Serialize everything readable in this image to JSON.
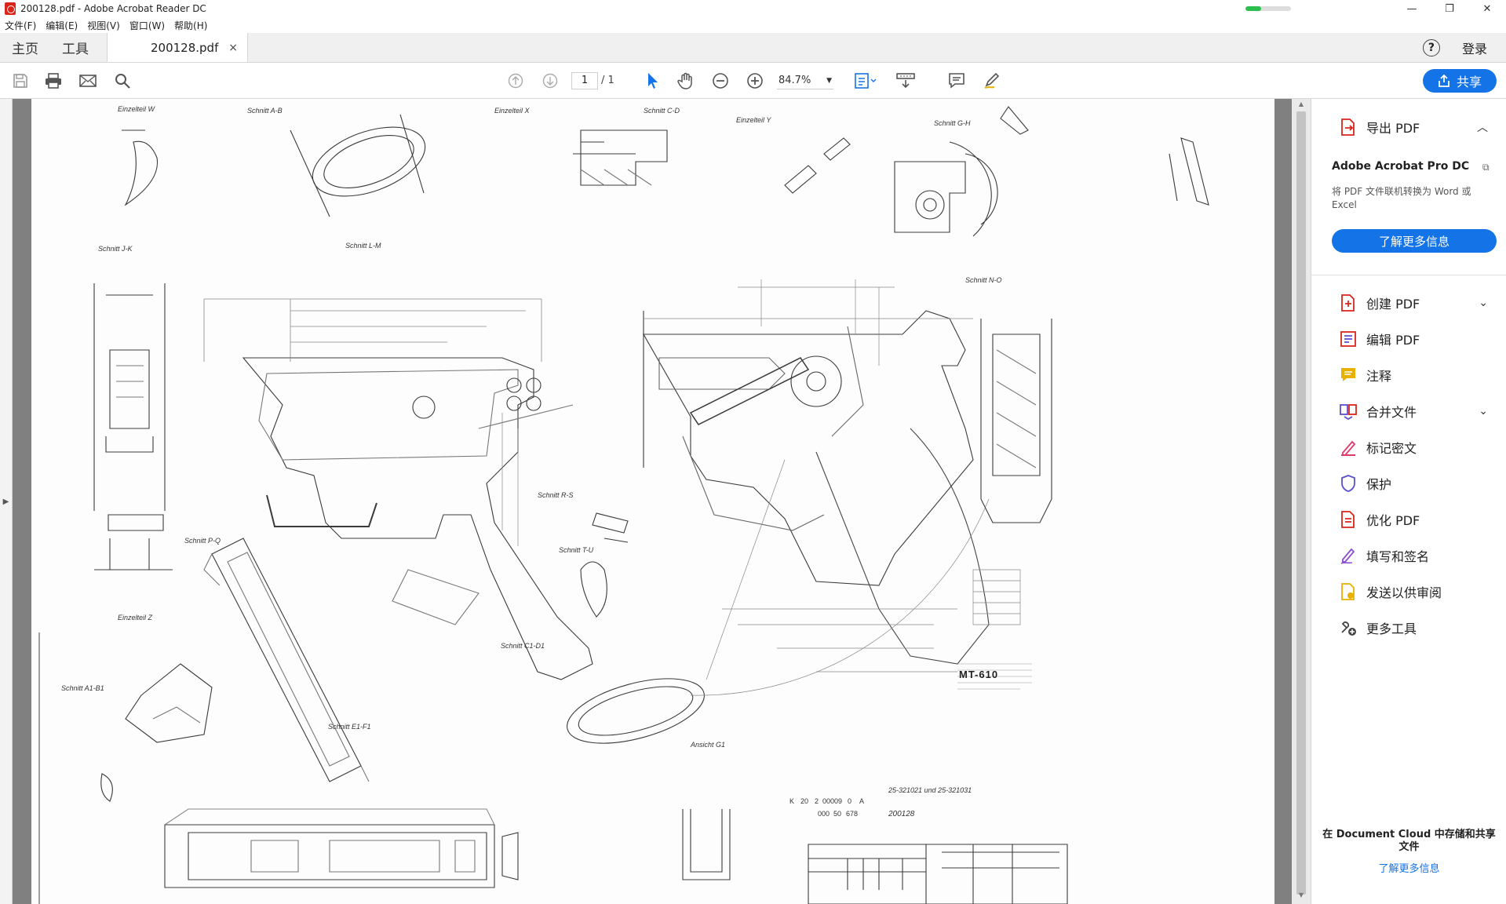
{
  "window": {
    "title": "200128.pdf - Adobe Acrobat Reader DC",
    "controls": {
      "minimize": "—",
      "maximize": "❐",
      "close": "✕"
    },
    "progress": 0.35
  },
  "menu": [
    "文件(F)",
    "编辑(E)",
    "视图(V)",
    "窗口(W)",
    "帮助(H)"
  ],
  "tabs": {
    "home": "主页",
    "tools": "工具",
    "document": "200128.pdf",
    "close": "×",
    "help": "?",
    "login": "登录"
  },
  "toolbar": {
    "page_current": "1",
    "page_total": "/ 1",
    "zoom": "84.7%",
    "share": "共享"
  },
  "drawing": {
    "labels": [
      "Einzelteil W",
      "Schnitt A-B",
      "Einzelteil X",
      "Schnitt C-D",
      "Einzelteil Y",
      "Schnitt G-H",
      "Schnitt J-K",
      "Schnitt L-M",
      "Schnitt N-O",
      "Schnitt R-S",
      "Schnitt T-U",
      "Schnitt P-Q",
      "Einzelteil Z",
      "Schnitt A1-B1",
      "Schnitt C1-D1",
      "Schnitt E1-F1",
      "Ansicht G1",
      "MT-610",
      "200128"
    ],
    "title_block": {
      "row1": [
        "K",
        "20",
        "2",
        "00009",
        "0",
        "A"
      ],
      "row2": [
        "000",
        "50",
        "678"
      ]
    },
    "ref": "25-321021 und 25-321031"
  },
  "panel": {
    "export": "导出 PDF",
    "promo_title": "Adobe Acrobat Pro DC",
    "promo_text": "将 PDF 文件联机转换为 Word 或 Excel",
    "promo_button": "了解更多信息",
    "tools": [
      {
        "label": "创建 PDF",
        "icon": "create-pdf-icon",
        "color": "#d9251c",
        "chev": "⌄"
      },
      {
        "label": "编辑 PDF",
        "icon": "edit-pdf-icon",
        "color": "#d9251c",
        "chev": ""
      },
      {
        "label": "注释",
        "icon": "comment-icon",
        "color": "#e8b100",
        "chev": ""
      },
      {
        "label": "合并文件",
        "icon": "combine-files-icon",
        "color": "#5a4fcf",
        "chev": "⌄"
      },
      {
        "label": "标记密文",
        "icon": "redact-icon",
        "color": "#e03a6c",
        "chev": ""
      },
      {
        "label": "保护",
        "icon": "protect-icon",
        "color": "#5a4fcf",
        "chev": ""
      },
      {
        "label": "优化 PDF",
        "icon": "optimize-pdf-icon",
        "color": "#d9251c",
        "chev": ""
      },
      {
        "label": "填写和签名",
        "icon": "fill-sign-icon",
        "color": "#8a4fcf",
        "chev": ""
      },
      {
        "label": "发送以供审阅",
        "icon": "send-review-icon",
        "color": "#e8b100",
        "chev": ""
      },
      {
        "label": "更多工具",
        "icon": "more-tools-icon",
        "color": "#444444",
        "chev": ""
      }
    ],
    "bottom_text": "在 Document Cloud 中存储和共享文件",
    "bottom_link": "了解更多信息"
  }
}
